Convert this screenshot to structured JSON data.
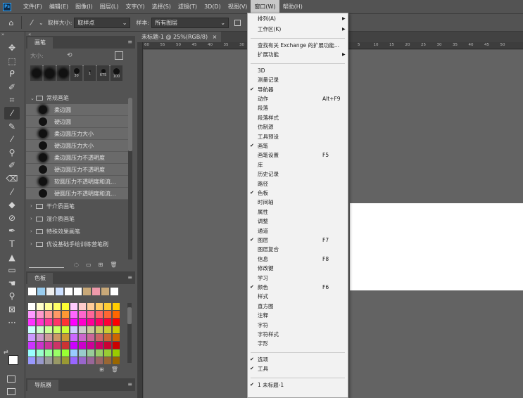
{
  "menubar": {
    "logo": "Ps",
    "items": [
      {
        "label": "文件(F)",
        "active": false
      },
      {
        "label": "编辑(E)",
        "active": false
      },
      {
        "label": "图像(I)",
        "active": false
      },
      {
        "label": "图层(L)",
        "active": false
      },
      {
        "label": "文字(Y)",
        "active": false
      },
      {
        "label": "选择(S)",
        "active": false
      },
      {
        "label": "滤镜(T)",
        "active": false
      },
      {
        "label": "3D(D)",
        "active": false
      },
      {
        "label": "视图(V)",
        "active": false
      },
      {
        "label": "窗口(W)",
        "active": true
      },
      {
        "label": "帮助(H)",
        "active": false
      }
    ]
  },
  "options": {
    "home_icon": "home-icon",
    "tool_icon": "eyedropper-icon",
    "sample_size_label": "取样大小:",
    "sample_size_value": "取样点",
    "sample_label": "样本:",
    "sample_value": "所有图层"
  },
  "brushes_panel": {
    "tab": "画笔",
    "size_label": "大小:",
    "presets": [
      {
        "num": "",
        "d": 12
      },
      {
        "num": "",
        "d": 13
      },
      {
        "num": "",
        "d": 12
      },
      {
        "num": "30",
        "d": 8
      },
      {
        "num": "1",
        "d": 2
      },
      {
        "num": "675",
        "d": 6
      },
      {
        "num": "100",
        "d": 9
      }
    ],
    "group_open": "常规画笔",
    "items": [
      {
        "label": "柔边圆",
        "style": "soft"
      },
      {
        "label": "硬边圆",
        "style": "hard"
      },
      {
        "label": "柔边圆压力大小",
        "style": "soft"
      },
      {
        "label": "硬边圆压力大小",
        "style": "hard"
      },
      {
        "label": "柔边圆压力不透明度",
        "style": "soft"
      },
      {
        "label": "硬边圆压力不透明度",
        "style": "hard"
      },
      {
        "label": "软圆压力不透明度和流...",
        "style": "soft"
      },
      {
        "label": "硬圆压力不透明度和流...",
        "style": "hard"
      }
    ],
    "groups": [
      "干介质画笔",
      "湿介质画笔",
      "特殊效果画笔",
      "优设基础手绘训练营笔刷"
    ]
  },
  "swatches_panel": {
    "tab": "色板",
    "recent": [
      "#ffffff",
      "#99ccee",
      "#eeeeee",
      "#cce0ff",
      "#ffffff",
      "#ffffff",
      "#c8a878",
      "#ee99aa",
      "#c8a878",
      "#ffffff"
    ],
    "grid": [
      [
        "#ffffff",
        "#ffffcc",
        "#ffff99",
        "#ffff66",
        "#ffff33",
        "#ffccff",
        "#ffcccc",
        "#ffcc99",
        "#ffcc66",
        "#ffcc33",
        "#ffcc00"
      ],
      [
        "#ff99ff",
        "#ff99cc",
        "#ff9999",
        "#ff9966",
        "#ff9933",
        "#ff66ff",
        "#ff66cc",
        "#ff6699",
        "#ff6666",
        "#ff6633",
        "#ff6600"
      ],
      [
        "#ff33ff",
        "#ff33cc",
        "#ff3399",
        "#ff3366",
        "#ff3333",
        "#ff00ff",
        "#ff00cc",
        "#ff0099",
        "#ff0066",
        "#ff0033",
        "#ff0000"
      ],
      [
        "#ccffff",
        "#ccffcc",
        "#ccff99",
        "#ccff66",
        "#ccff33",
        "#ccccff",
        "#cccccc",
        "#cccc99",
        "#cccc66",
        "#cccc33",
        "#cccc00"
      ],
      [
        "#cc99ff",
        "#cc99cc",
        "#cc9999",
        "#cc9966",
        "#cc9933",
        "#cc66ff",
        "#cc66cc",
        "#cc6699",
        "#cc6666",
        "#cc6633",
        "#cc6600"
      ],
      [
        "#cc33ff",
        "#cc33cc",
        "#cc3399",
        "#cc3366",
        "#cc3333",
        "#cc00ff",
        "#cc00cc",
        "#cc0099",
        "#cc0066",
        "#cc0033",
        "#cc0000"
      ],
      [
        "#99ffff",
        "#99ffcc",
        "#99ff99",
        "#99ff66",
        "#99ff33",
        "#99ccff",
        "#99cccc",
        "#99cc99",
        "#99cc66",
        "#99cc33",
        "#99cc00"
      ],
      [
        "#9999ff",
        "#9999cc",
        "#999999",
        "#999966",
        "#999933",
        "#9966ff",
        "#9966cc",
        "#996699",
        "#996666",
        "#996633",
        "#996600"
      ]
    ]
  },
  "navigator_panel": {
    "tab": "导航器"
  },
  "document": {
    "tab": "未标题-1 @ 25%(RGB/8)",
    "close": "×",
    "ruler_ticks": [
      "60",
      "55",
      "50",
      "45",
      "40",
      "35",
      "30",
      "5",
      "10",
      "15",
      "20",
      "25",
      "30",
      "35",
      "40",
      "45",
      "50"
    ]
  },
  "window_menu": {
    "items": [
      {
        "label": "排列(A)",
        "submenu": true
      },
      {
        "label": "工作区(K)",
        "submenu": true
      },
      {
        "sep": true
      },
      {
        "label": "查找有关 Exchange 的扩展功能..."
      },
      {
        "label": "扩展功能",
        "submenu": true
      },
      {
        "sep": true
      },
      {
        "label": "3D"
      },
      {
        "label": "测量记录"
      },
      {
        "label": "导航器",
        "checked": true
      },
      {
        "label": "动作",
        "shortcut": "Alt+F9"
      },
      {
        "label": "段落"
      },
      {
        "label": "段落样式"
      },
      {
        "label": "仿制源"
      },
      {
        "label": "工具预设"
      },
      {
        "label": "画笔",
        "checked": true
      },
      {
        "label": "画笔设置",
        "shortcut": "F5"
      },
      {
        "label": "库"
      },
      {
        "label": "历史记录"
      },
      {
        "label": "路径"
      },
      {
        "label": "色板",
        "checked": true
      },
      {
        "label": "时间轴"
      },
      {
        "label": "属性"
      },
      {
        "label": "调整"
      },
      {
        "label": "通道"
      },
      {
        "label": "图层",
        "checked": true,
        "shortcut": "F7"
      },
      {
        "label": "图层复合"
      },
      {
        "label": "信息",
        "shortcut": "F8"
      },
      {
        "label": "修改键"
      },
      {
        "label": "学习"
      },
      {
        "label": "颜色",
        "checked": true,
        "shortcut": "F6"
      },
      {
        "label": "样式"
      },
      {
        "label": "直方图"
      },
      {
        "label": "注释"
      },
      {
        "label": "字符"
      },
      {
        "label": "字符样式"
      },
      {
        "label": "字形"
      },
      {
        "sep": true
      },
      {
        "label": "选项",
        "checked": true
      },
      {
        "label": "工具",
        "checked": true
      },
      {
        "sep": true
      },
      {
        "label": "1 未标题-1",
        "checked": true
      }
    ]
  },
  "toolbar": {
    "tools": [
      {
        "name": "move-tool-icon",
        "glyph": "✥"
      },
      {
        "name": "marquee-tool-icon",
        "glyph": "⬚"
      },
      {
        "name": "lasso-tool-icon",
        "glyph": "ᑭ"
      },
      {
        "name": "quick-select-tool-icon",
        "glyph": "✐"
      },
      {
        "name": "crop-tool-icon",
        "glyph": "⌗"
      },
      {
        "name": "eyedropper-tool-icon",
        "glyph": "⁄"
      },
      {
        "name": "spot-healing-tool-icon",
        "glyph": "✎"
      },
      {
        "name": "brush-tool-icon",
        "glyph": "⁄"
      },
      {
        "name": "clone-stamp-tool-icon",
        "glyph": "⚲"
      },
      {
        "name": "history-brush-tool-icon",
        "glyph": "✐"
      },
      {
        "name": "eraser-tool-icon",
        "glyph": "⌫"
      },
      {
        "name": "gradient-tool-icon",
        "glyph": "⁄"
      },
      {
        "name": "blur-tool-icon",
        "glyph": "◆"
      },
      {
        "name": "dodge-tool-icon",
        "glyph": "⊘"
      },
      {
        "name": "pen-tool-icon",
        "glyph": "✒"
      },
      {
        "name": "type-tool-icon",
        "glyph": "T"
      },
      {
        "name": "path-select-tool-icon",
        "glyph": "▲"
      },
      {
        "name": "rectangle-tool-icon",
        "glyph": "▭"
      },
      {
        "name": "hand-tool-icon",
        "glyph": "☚"
      },
      {
        "name": "zoom-tool-icon",
        "glyph": "⚲"
      },
      {
        "name": "frame-tool-icon",
        "glyph": "⊠"
      },
      {
        "name": "more-tools-icon",
        "glyph": "···"
      }
    ]
  }
}
